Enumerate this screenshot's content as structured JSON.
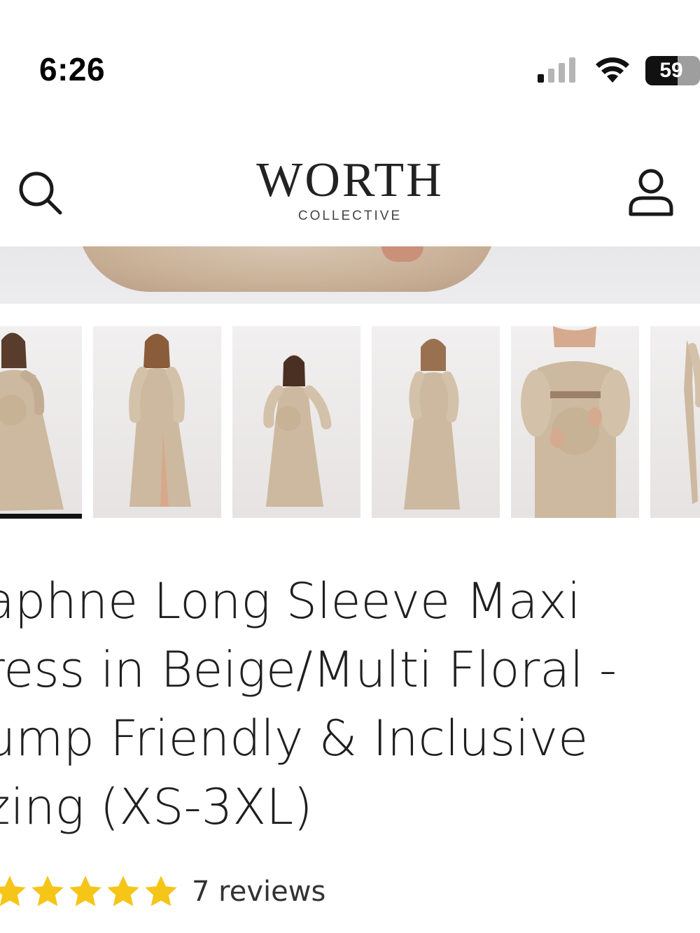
{
  "status_bar": {
    "time": "6:26",
    "battery_level": "59",
    "battery_fraction": 0.59
  },
  "header": {
    "brand_name": "WORTH",
    "brand_sub": "COLLECTIVE",
    "search_icon": "search-icon",
    "account_icon": "user-icon"
  },
  "gallery": {
    "thumbnail_count": 6,
    "selected_index": 0
  },
  "product": {
    "title": "aphne Long Sleeve Maxi\nress in Beige/Multi Floral -\nump Friendly & Inclusive\nzing (XS-3XL)",
    "rating_stars": 5,
    "reviews_label": "7 reviews",
    "star_color": "#f5c518"
  },
  "colors": {
    "accent_dark": "#111111",
    "dress_beige": "#cdb9a0"
  }
}
